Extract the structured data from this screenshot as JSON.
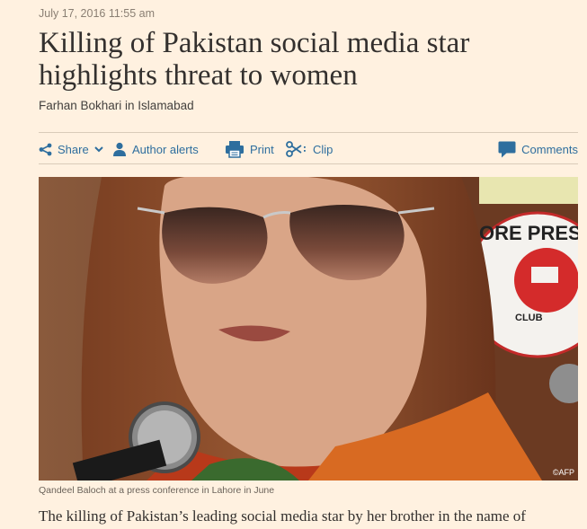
{
  "article": {
    "date": "July 17, 2016 11:55 am",
    "title": "Killing of Pakistan social media star highlights threat to women",
    "byline": "Farhan Bokhari in Islamabad"
  },
  "toolbar": {
    "share_label": "Share",
    "author_alerts_label": "Author alerts",
    "print_label": "Print",
    "clip_label": "Clip",
    "comments_label": "Comments",
    "accent_color": "#2e6e9e",
    "icons": [
      "share-icon",
      "chevron-down-icon",
      "person-icon",
      "printer-icon",
      "scissors-icon",
      "comment-icon"
    ]
  },
  "image": {
    "credit": "©AFP",
    "caption": "Qandeel Baloch at a press conference in Lahore in June",
    "sign_text_top": "ORE PRES",
    "sign_text_club": "CLUB"
  },
  "body": {
    "first_line": "The killing of Pakistan’s leading social media star by her brother in the name of"
  },
  "colors": {
    "page_background": "#fff1e0",
    "title": "#33302e",
    "link": "#2e6e9e",
    "rule": "#d9cbb9"
  }
}
